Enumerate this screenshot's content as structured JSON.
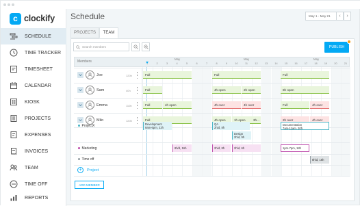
{
  "app": {
    "logo_text": "clockify",
    "logo_letter": "c"
  },
  "sidebar": {
    "items": [
      {
        "label": "SCHEDULE",
        "icon": "schedule-icon",
        "active": true
      },
      {
        "label": "TIME TRACKER",
        "icon": "clock-icon"
      },
      {
        "label": "TIMESHEET",
        "icon": "timesheet-icon"
      },
      {
        "label": "CALENDAR",
        "icon": "calendar-icon"
      },
      {
        "label": "KIOSK",
        "icon": "kiosk-icon"
      },
      {
        "label": "PROJECTS",
        "icon": "projects-icon"
      },
      {
        "label": "EXPENSES",
        "icon": "expenses-icon"
      },
      {
        "label": "INVOICES",
        "icon": "invoices-icon"
      },
      {
        "label": "TEAM",
        "icon": "team-icon"
      },
      {
        "label": "TIME OFF",
        "icon": "time-off-icon"
      },
      {
        "label": "REPORTS",
        "icon": "reports-icon"
      }
    ]
  },
  "header": {
    "title": "Schedule",
    "date_range": "May 1 - May 21",
    "prev": "‹",
    "next": "›"
  },
  "tabs": [
    {
      "label": "PROJECTS"
    },
    {
      "label": "TEAM",
      "active": true
    }
  ],
  "toolbar": {
    "search_placeholder": "Search members",
    "publish_label": "PUBLISH"
  },
  "grid": {
    "members_header": "Members",
    "months": [
      "May",
      "May",
      "May"
    ],
    "days": [
      "1",
      "2",
      "3",
      "4",
      "5",
      "6",
      "7",
      "8",
      "9",
      "10",
      "11",
      "12",
      "13",
      "14",
      "15",
      "16",
      "17",
      "18",
      "19",
      "20",
      "21"
    ]
  },
  "members": [
    {
      "name": "Joe",
      "hours": "120h",
      "bars": [
        {
          "text": "Full",
          "kind": "full"
        },
        {
          "text": "Full",
          "kind": "full"
        },
        {
          "text": "Full",
          "kind": "full"
        }
      ]
    },
    {
      "name": "Sam",
      "hours": "40h",
      "bars": [
        {
          "text": "Full",
          "kind": "full"
        },
        {
          "text": "4h open",
          "kind": "open"
        },
        {
          "text": "2h open",
          "kind": "open"
        },
        {
          "text": "8h open",
          "kind": "open"
        }
      ]
    },
    {
      "name": "Emma",
      "hours": "110h",
      "bars": [
        {
          "text": "Full",
          "kind": "full"
        },
        {
          "text": "4h open",
          "kind": "open"
        },
        {
          "text": "4h over",
          "kind": "over"
        },
        {
          "text": "4h over",
          "kind": "over"
        },
        {
          "text": "Full",
          "kind": "full"
        },
        {
          "text": "4h over",
          "kind": "over"
        }
      ]
    },
    {
      "name": "Milo",
      "hours": "120h",
      "bars": [
        {
          "text": "Full",
          "kind": "full"
        },
        {
          "text": "4h open",
          "kind": "open"
        },
        {
          "text": "1h open",
          "kind": "open"
        },
        {
          "text": "3h...",
          "kind": "open"
        },
        {
          "text": "2h over",
          "kind": "over"
        },
        {
          "text": "4h over",
          "kind": "over"
        }
      ]
    }
  ],
  "projects": [
    {
      "name": "ProjectX",
      "color": "#4db6c7",
      "blocks": [
        {
          "line1": "Development",
          "line2": "9am-6pm, 22h"
        },
        {
          "line1": "QA",
          "line2": "2h/d, 8h"
        },
        {
          "line1": "Design",
          "line2": "2h/d, 9h"
        },
        {
          "line1": "Documentation",
          "line2": "7am-11am, 20h"
        }
      ]
    },
    {
      "name": "Marketing",
      "color": "#c155b0",
      "blocks": [
        {
          "line1": "8h/d, 16h"
        },
        {
          "line1": "2h/d, 8h"
        },
        {
          "line1": "2h/d, 6h"
        },
        {
          "line1": "1pm-7pm, 18h"
        }
      ]
    },
    {
      "name": "Time off",
      "color": "#9aa3a8",
      "blocks": [
        {
          "line1": "8h/d, 16h"
        }
      ]
    }
  ],
  "add_project_label": "Project",
  "add_member_label": "ADD MEMBER",
  "colors": {
    "accent": "#03a9f4",
    "full": "#8bc34a",
    "over": "#e57373"
  }
}
